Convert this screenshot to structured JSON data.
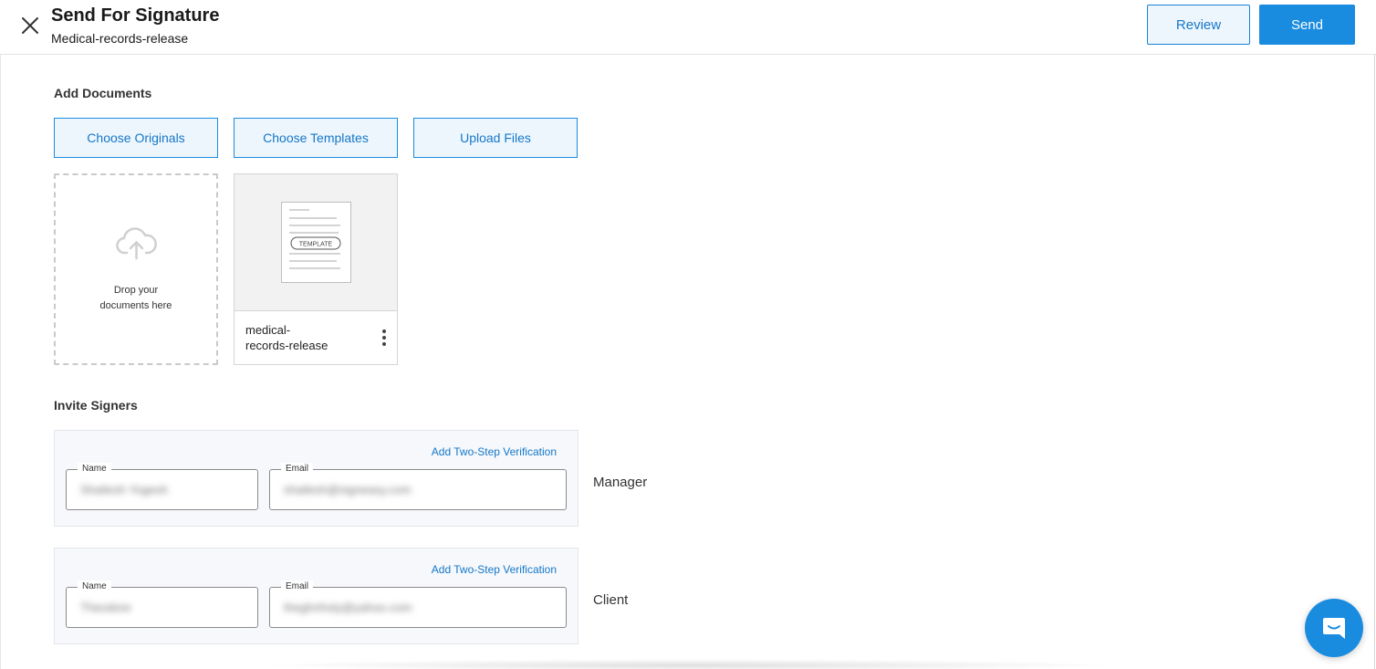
{
  "header": {
    "title": "Send For Signature",
    "subtitle": "Medical-records-release",
    "review_label": "Review",
    "send_label": "Send"
  },
  "documents": {
    "section_title": "Add Documents",
    "buttons": [
      "Choose Originals",
      "Choose Templates",
      "Upload Files"
    ],
    "dropzone_text_line1": "Drop your",
    "dropzone_text_line2": "documents here",
    "template_badge": "TEMPLATE",
    "card_name_line1": "medical-",
    "card_name_line2": "records-release"
  },
  "signers": {
    "section_title": "Invite Signers",
    "items": [
      {
        "two_step_label": "Add Two-Step Verification",
        "name_label": "Name",
        "name_value": "Shailesh Yogesh",
        "email_label": "Email",
        "email_value": "shailesh@signeasy.com",
        "role": "Manager"
      },
      {
        "two_step_label": "Add Two-Step Verification",
        "name_label": "Name",
        "name_value": "Theodore",
        "email_label": "Email",
        "email_value": "theghnholy@yahoo.com",
        "role": "Client"
      }
    ]
  },
  "icons": {
    "close": "close-icon",
    "upload": "cloud-upload-icon",
    "more": "more-vertical-icon",
    "chat": "chat-icon"
  },
  "colors": {
    "accent": "#1a8ce0",
    "accent_text": "#1477c9",
    "accent_bg": "#eef6fd"
  }
}
